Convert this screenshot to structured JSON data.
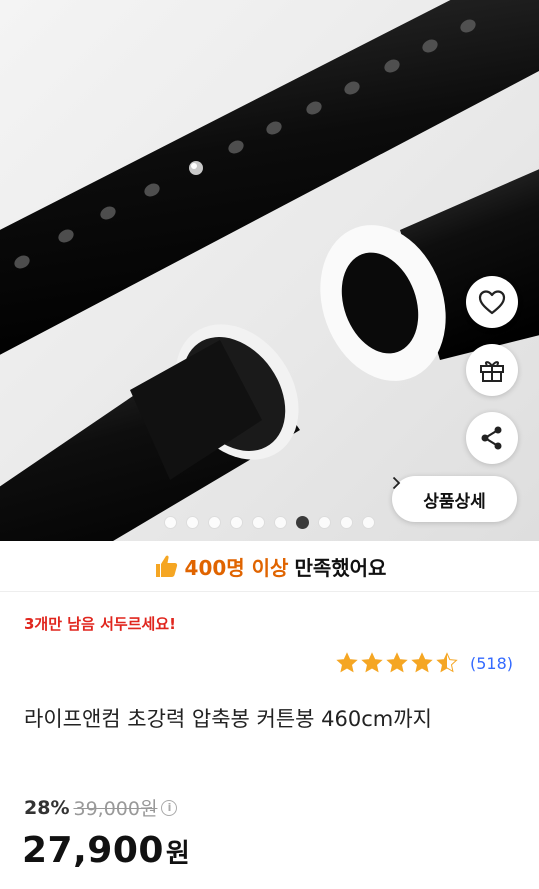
{
  "gallery": {
    "total_images": 10,
    "active_index": 6
  },
  "actions": {
    "detail_label": "상품상세"
  },
  "satisfaction": {
    "highlight": "400명 이상",
    "suffix": "만족했어요"
  },
  "urgency_text": "3개만 남음 서두르세요!",
  "rating": {
    "stars": 4.5,
    "review_count": "(518)"
  },
  "product": {
    "title": "라이프앤컴 초강력 압축봉 커튼봉 460cm까지"
  },
  "pricing": {
    "discount_rate": "28%",
    "original_price": "39,000원",
    "sale_price": "27,900",
    "currency": "원"
  },
  "colors": {
    "accent_orange": "#e06400",
    "urgency_red": "#e0261e",
    "star": "#f5a623",
    "link_blue": "#346aff"
  }
}
